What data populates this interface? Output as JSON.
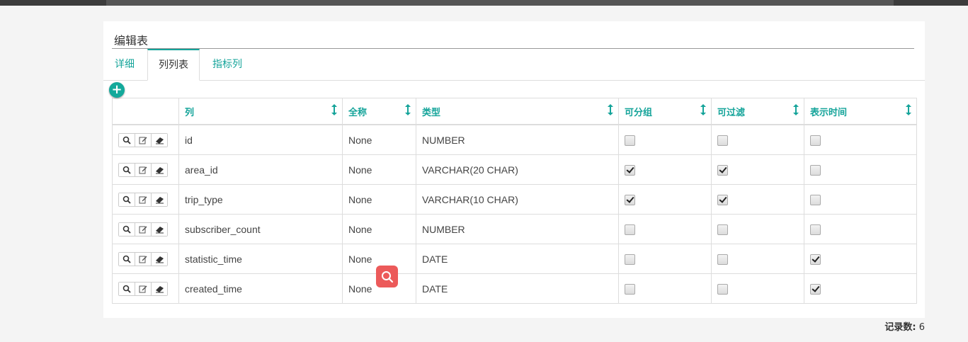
{
  "panel": {
    "title": "编辑表"
  },
  "tabs": [
    {
      "label": "详细",
      "active": false
    },
    {
      "label": "列列表",
      "active": true
    },
    {
      "label": "指标列",
      "active": false
    }
  ],
  "add_button": {
    "icon": "plus-icon"
  },
  "table": {
    "columns": [
      "列",
      "全称",
      "类型",
      "可分组",
      "可过滤",
      "表示时间"
    ],
    "row_actions": [
      "search-icon",
      "edit-icon",
      "eraser-icon"
    ],
    "rows": [
      {
        "name": "id",
        "fullname": "None",
        "type": "NUMBER",
        "groupable": false,
        "filterable": false,
        "is_dttm": false
      },
      {
        "name": "area_id",
        "fullname": "None",
        "type": "VARCHAR(20 CHAR)",
        "groupable": true,
        "filterable": true,
        "is_dttm": false
      },
      {
        "name": "trip_type",
        "fullname": "None",
        "type": "VARCHAR(10 CHAR)",
        "groupable": true,
        "filterable": true,
        "is_dttm": false
      },
      {
        "name": "subscriber_count",
        "fullname": "None",
        "type": "NUMBER",
        "groupable": false,
        "filterable": false,
        "is_dttm": false
      },
      {
        "name": "statistic_time",
        "fullname": "None",
        "type": "DATE",
        "groupable": false,
        "filterable": false,
        "is_dttm": true
      },
      {
        "name": "created_time",
        "fullname": "None",
        "type": "DATE",
        "groupable": false,
        "filterable": false,
        "is_dttm": true
      }
    ]
  },
  "footer": {
    "records_label": "记录数:",
    "records_count": "6"
  },
  "floating_button": {
    "icon": "magnifier-icon"
  },
  "colors": {
    "accent": "#15a49a",
    "floating": "#ec5a5a"
  }
}
